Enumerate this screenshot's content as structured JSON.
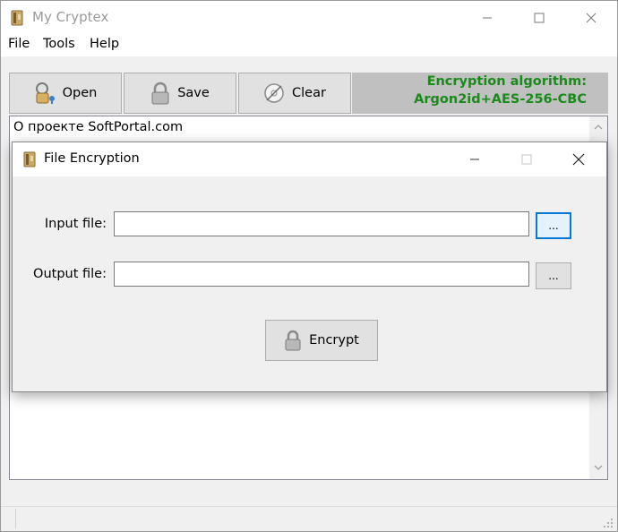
{
  "window": {
    "title": "My Cryptex",
    "icon": "cryptex-book-icon",
    "controls": {
      "minimize": "—",
      "maximize": "☐",
      "close": "✕"
    }
  },
  "menu": [
    {
      "label": "File"
    },
    {
      "label": "Tools"
    },
    {
      "label": "Help"
    }
  ],
  "toolbar": {
    "open_label": "Open",
    "save_label": "Save",
    "clear_label": "Clear",
    "algorithm_line1": "Encryption algorithm:",
    "algorithm_line2": "Argon2id+AES-256-CBC",
    "algorithm_color": "#1a8a1a"
  },
  "editor": {
    "text": "О проекте SoftPortal.com"
  },
  "dialog": {
    "title": "File Encryption",
    "controls": {
      "minimize": "—",
      "maximize": "☐",
      "close": "✕"
    },
    "input_label": "Input file:",
    "input_value": "",
    "input_browse": "...",
    "output_label": "Output file:",
    "output_value": "",
    "output_browse": "...",
    "encrypt_label": "Encrypt"
  },
  "colors": {
    "focus_border": "#0078d7",
    "button_face": "#e1e1e1",
    "panel_gray": "#c0c0c0"
  }
}
